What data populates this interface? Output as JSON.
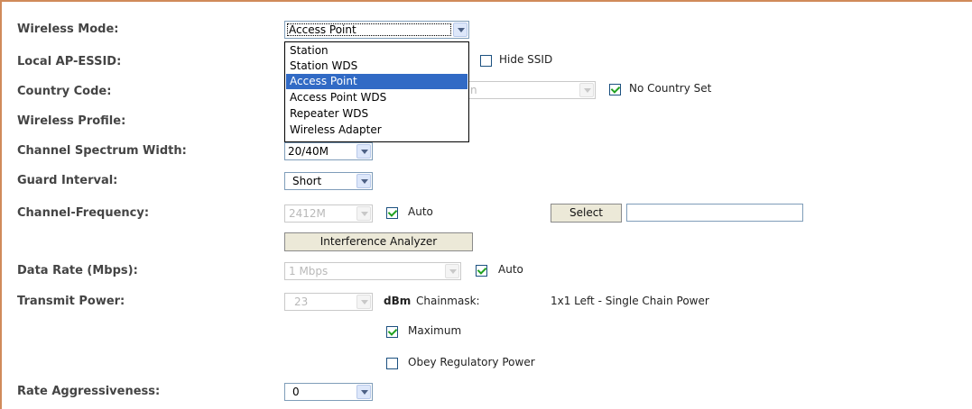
{
  "form": {
    "wireless_mode": {
      "label": "Wireless Mode:",
      "value": "Access Point",
      "options": [
        "Station",
        "Station WDS",
        "Access Point",
        "Access Point WDS",
        "Repeater WDS",
        "Wireless Adapter"
      ],
      "selected_option": "Access Point"
    },
    "local_ap_essid": {
      "label": "Local AP-ESSID:",
      "hide_ssid_label": "Hide SSID",
      "hide_ssid_checked": false
    },
    "country_code": {
      "label": "Country Code:",
      "partial_value": "n",
      "no_country_label": "No Country Set",
      "no_country_checked": true
    },
    "wireless_profile": {
      "label": "Wireless Profile:"
    },
    "channel_spectrum_width": {
      "label": "Channel Spectrum Width:",
      "value": "20/40M"
    },
    "guard_interval": {
      "label": "Guard Interval:",
      "value": "Short"
    },
    "channel_frequency": {
      "label": "Channel-Frequency:",
      "value": "2412M",
      "auto_label": "Auto",
      "auto_checked": true,
      "select_button": "Select",
      "input_value": ""
    },
    "interference_analyzer": {
      "label": "Interference Analyzer"
    },
    "data_rate": {
      "label": "Data Rate (Mbps):",
      "value": "1 Mbps",
      "auto_label": "Auto",
      "auto_checked": true
    },
    "transmit_power": {
      "label": "Transmit Power:",
      "value": "23",
      "unit": "dBm",
      "chainmask_label": "Chainmask:",
      "chainmask_value": "1x1 Left - Single Chain Power",
      "maximum_label": "Maximum",
      "maximum_checked": true,
      "obey_label": "Obey Regulatory Power",
      "obey_checked": false
    },
    "rate_aggressiveness": {
      "label": "Rate Aggressiveness:",
      "value": "0"
    }
  },
  "colors": {
    "frame": "#d08a5a",
    "selection": "#316ac5",
    "check": "#21a121"
  }
}
